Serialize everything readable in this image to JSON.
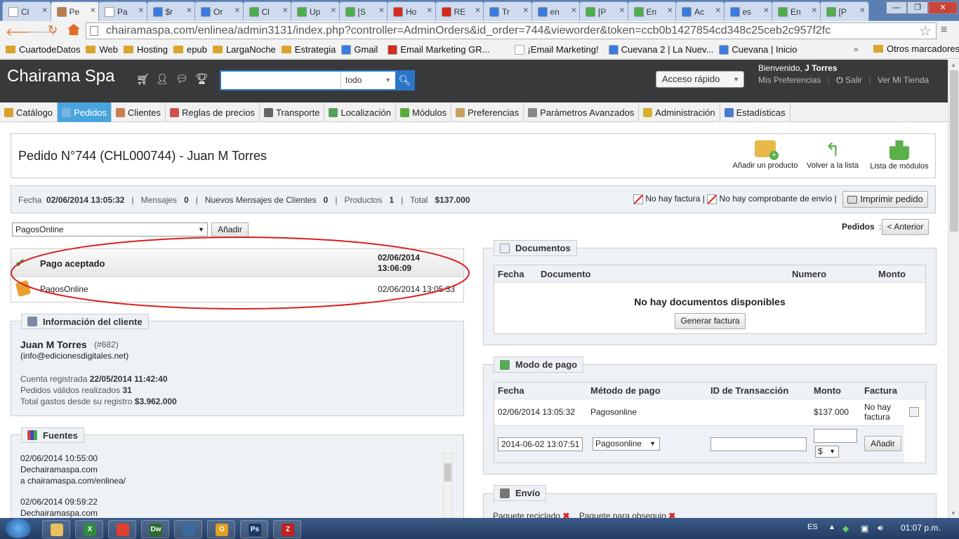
{
  "browser": {
    "tabs": [
      {
        "label": "Cl",
        "color": "#ffffff"
      },
      {
        "label": "Pe",
        "color": "#b87c4c"
      },
      {
        "label": "Pa",
        "color": "#ffffff"
      },
      {
        "label": "$r",
        "color": "#3a7be0"
      },
      {
        "label": "Or",
        "color": "#3a7be0"
      },
      {
        "label": "Cl",
        "color": "#4cae4c"
      },
      {
        "label": "Up",
        "color": "#4cae4c"
      },
      {
        "label": "[S",
        "color": "#4cae4c"
      },
      {
        "label": "Ho",
        "color": "#d52b1e"
      },
      {
        "label": "RE",
        "color": "#d52b1e"
      },
      {
        "label": "Tr",
        "color": "#3a7be0"
      },
      {
        "label": "en",
        "color": "#3a7be0"
      },
      {
        "label": "[P",
        "color": "#4cae4c"
      },
      {
        "label": "En",
        "color": "#4cae4c"
      },
      {
        "label": "Ac",
        "color": "#3a7be0"
      },
      {
        "label": "es",
        "color": "#3a7be0"
      },
      {
        "label": "En",
        "color": "#4cae4c"
      },
      {
        "label": "[P",
        "color": "#4cae4c"
      }
    ],
    "url": "chairamaspa.com/enlinea/admin3131/index.php?controller=AdminOrders&id_order=744&vieworder&token=ccb0b1427854cd348c25ceb2c957f2fc",
    "bookmarks": [
      "CuartodeDatos",
      "Web",
      "Hosting",
      "epub",
      "LargaNoche",
      "Estrategia",
      "Gmail",
      "Email Marketing GR...",
      "¡Email Marketing!",
      "Cuevana 2 | La Nuev...",
      "Cuevana | Inicio"
    ],
    "bookmarks_more": "»",
    "other_bookmarks": "Otros marcadores"
  },
  "header": {
    "brand": "Chairama Spa",
    "search_scope": "todo",
    "quick_access": "Acceso rápido",
    "welcome_prefix": "Bienvenido,",
    "welcome_user": "J Torres",
    "preferences": "Mis Preferencias",
    "logout": "Salir",
    "view_store": "Ver Mi Tienda"
  },
  "nav": [
    {
      "label": "Catálogo",
      "icon": "#d8a030"
    },
    {
      "label": "Pedidos",
      "icon": "#7ab3e0",
      "active": true
    },
    {
      "label": "Clientes",
      "icon": "#c88050"
    },
    {
      "label": "Reglas de precios",
      "icon": "#d05050"
    },
    {
      "label": "Transporte",
      "icon": "#666666"
    },
    {
      "label": "Localización",
      "icon": "#5aa05a"
    },
    {
      "label": "Módulos",
      "icon": "#5aaa3a"
    },
    {
      "label": "Preferencias",
      "icon": "#c8a060"
    },
    {
      "label": "Parámetros Avanzados",
      "icon": "#888888"
    },
    {
      "label": "Administración",
      "icon": "#d8b030"
    },
    {
      "label": "Estadísticas",
      "icon": "#4a7ad0"
    }
  ],
  "order": {
    "title": "Pedido N°744 (CHL000744) - Juan M Torres",
    "toolbar": {
      "add_product": "Añadir un producto",
      "back": "Volver a la lista",
      "modules": "Lista de módulos"
    },
    "summary": {
      "date_label": "Fecha",
      "date": "02/06/2014 13:05:32",
      "messages_label": "Mensajes",
      "messages": "0",
      "new_messages_label": "Nuevos Mensajes de Clientes",
      "new_messages": "0",
      "products_label": "Productos",
      "products": "1",
      "total_label": "Total",
      "total": "$137.000",
      "sep": "|"
    },
    "no_invoice": "No hay factura",
    "no_delivery": "No hay comprobante de envío",
    "print": "Imprimir pedido",
    "status_select": "PagosOnline",
    "add": "Añadir",
    "orders_label": "Pedidos",
    "colon": ":",
    "previous": "< Anterior",
    "history": [
      {
        "status": "Pago aceptado",
        "date": "02/06/2014 13:06:09"
      },
      {
        "status": "PagosOnline",
        "date": "02/06/2014 13:05:33"
      }
    ]
  },
  "customer": {
    "legend": "Información del cliente",
    "name": "Juan M Torres",
    "id": "(#682)",
    "email": "(info@edicionesdigitales.net)",
    "registered_label": "Cuenta registrada",
    "registered": "22/05/2014 11:42:40",
    "orders_label": "Pedidos válidos realizados",
    "orders": "31",
    "spent_label": "Total gastos desde su registro",
    "spent": "$3.962.000"
  },
  "sources": {
    "legend": "Fuentes",
    "entries": [
      {
        "date": "02/06/2014 10:55:00",
        "from": "Dechairamaspa.com",
        "to": "a chairamaspa.com/enlinea/"
      },
      {
        "date": "02/06/2014 09:59:22",
        "from": "Dechairamaspa.com",
        "to": ""
      }
    ]
  },
  "documents": {
    "legend": "Documentos",
    "headers": [
      "Fecha",
      "Documento",
      "Numero",
      "Monto"
    ],
    "empty": "No hay documentos disponibles",
    "generate": "Generar factura"
  },
  "payment": {
    "legend": "Modo de pago",
    "headers": [
      "Fecha",
      "Método de pago",
      "ID de Transacción",
      "Monto",
      "Factura"
    ],
    "row": {
      "date": "02/06/2014 13:05:32",
      "method": "Pagosonline",
      "transaction": "",
      "amount": "$137.000",
      "invoice": "No hay factura"
    },
    "new": {
      "date": "2014-06-02 13:07:51",
      "method": "Pagosonline",
      "currency": "$",
      "add": "Añadir"
    }
  },
  "shipping": {
    "legend": "Envío",
    "recycled": "Paquete reciclado",
    "gift": "Paquete para obsequio"
  },
  "taskbar": {
    "lang": "ES",
    "time": "01:07 p.m.",
    "apps": [
      {
        "name": "explorer",
        "color": "#e8c060"
      },
      {
        "name": "excel",
        "color": "#2f8a3f",
        "glyph": "X"
      },
      {
        "name": "chrome",
        "color": "#e04030"
      },
      {
        "name": "dreamweaver",
        "color": "#2a6a2a",
        "glyph": "Dw"
      },
      {
        "name": "app5",
        "color": "#3a6aa0"
      },
      {
        "name": "outlook",
        "color": "#e0a020",
        "glyph": "O"
      },
      {
        "name": "photoshop",
        "color": "#1a3a6a",
        "glyph": "Ps"
      },
      {
        "name": "filezilla",
        "color": "#c02020",
        "glyph": "Z"
      }
    ]
  }
}
